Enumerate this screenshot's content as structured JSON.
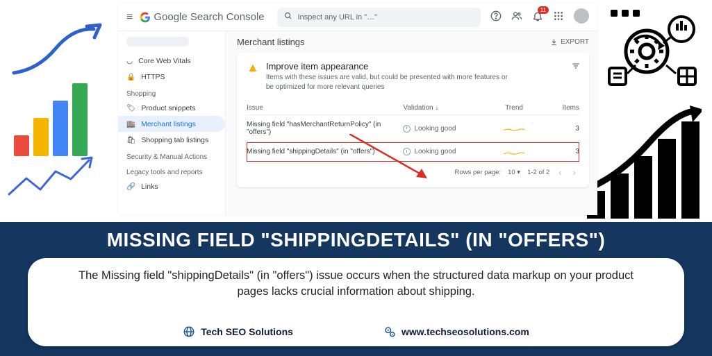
{
  "gsc": {
    "product": "Google",
    "product_suffix": "Search Console",
    "search_placeholder": "Inspect any URL in \"…\"",
    "notif_count": "11",
    "sidebar": {
      "items": [
        {
          "label": "Core Web Vitals"
        },
        {
          "label": "HTTPS"
        }
      ],
      "cat1": "Shopping",
      "shopping": [
        {
          "label": "Product snippets"
        },
        {
          "label": "Merchant listings"
        },
        {
          "label": "Shopping tab listings"
        }
      ],
      "cat2": "Security & Manual Actions",
      "cat3": "Legacy tools and reports",
      "links": "Links"
    },
    "page_title": "Merchant listings",
    "export": "EXPORT",
    "card": {
      "title": "Improve item appearance",
      "sub": "Items with these issues are valid, but could be presented with more features or be optimized for more relevant queries"
    },
    "table": {
      "h_issue": "Issue",
      "h_validation": "Validation",
      "h_trend": "Trend",
      "h_items": "Items",
      "rows": [
        {
          "issue": "Missing field \"hasMerchantReturnPolicy\" (in \"offers\")",
          "validation": "Looking good",
          "items": "3"
        },
        {
          "issue": "Missing field \"shippingDetails\" (in \"offers\")",
          "validation": "Looking good",
          "items": "3"
        }
      ],
      "pager_label": "Rows per page:",
      "pager_size": "10",
      "pager_range": "1-2 of 2"
    }
  },
  "banner": {
    "hero": "MISSING FIELD \"SHIPPINGDETAILS\" (IN \"OFFERS\")",
    "desc": "The Missing field \"shippingDetails\" (in \"offers\") issue occurs when the structured data markup on your product pages lacks crucial information about shipping.",
    "brand": "Tech SEO Solutions",
    "url": "www.techseosolutions.com"
  }
}
